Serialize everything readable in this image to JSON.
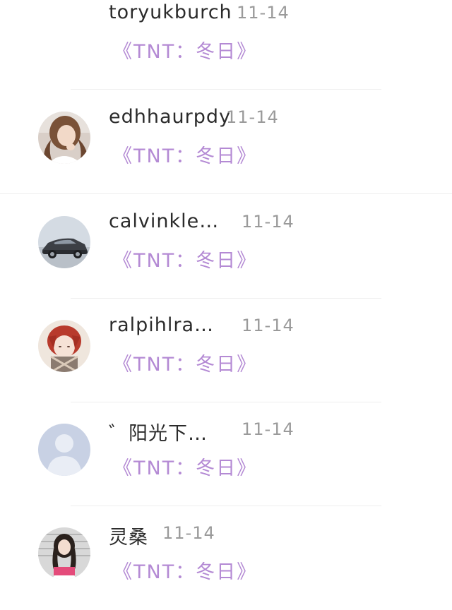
{
  "comments": [
    {
      "username": "toryukburch",
      "date": "11-14",
      "book_title": "《TNT：冬日》",
      "avatar": "none"
    },
    {
      "username": "edhhaurpdy",
      "date": "11-14",
      "book_title": "《TNT：冬日》",
      "avatar": "avatar-photo-girl-icon"
    },
    {
      "username": "calvinkle…",
      "date": "11-14",
      "book_title": "《TNT：冬日》",
      "avatar": "avatar-car-icon"
    },
    {
      "username": "ralpihlra…",
      "date": "11-14",
      "book_title": "《TNT：冬日》",
      "avatar": "avatar-anime-red-hair-icon"
    },
    {
      "username": "゛阳光下…",
      "date": "11-14",
      "book_title": "《TNT：冬日》",
      "avatar": "default-avatar-icon"
    },
    {
      "username": "灵桑",
      "date": "11-14",
      "book_title": "《TNT：冬日》",
      "avatar": "avatar-photo-girl-reading-icon"
    }
  ],
  "colors": {
    "username": "#2b2b2b",
    "date": "#9a9a9a",
    "book_title": "#b48ad4",
    "divider": "#eeeeee",
    "default_avatar_bg": "#c8d1e4"
  }
}
